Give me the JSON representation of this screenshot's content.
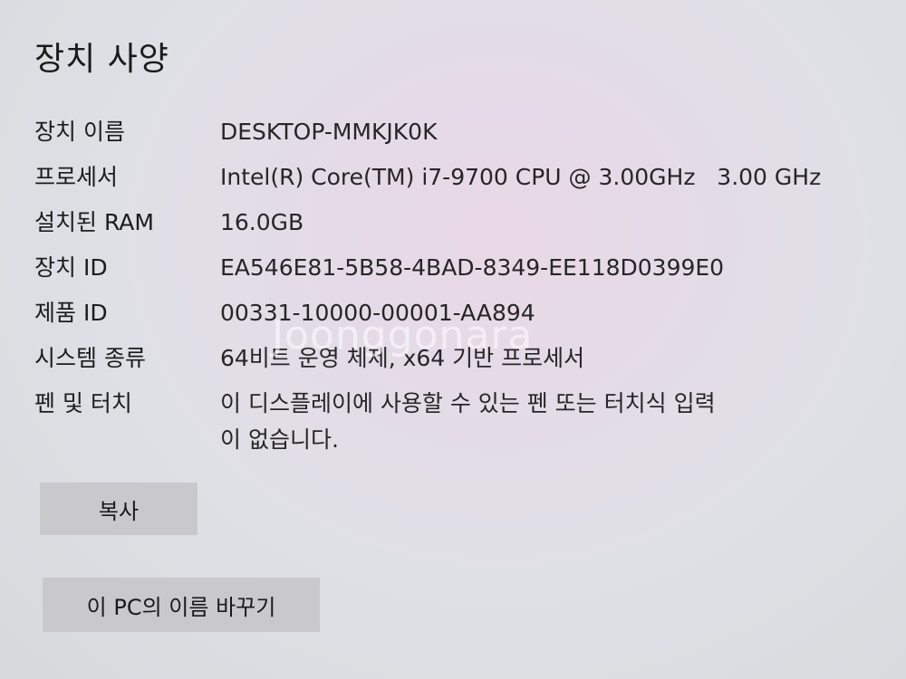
{
  "title": "장치 사양",
  "specs": [
    {
      "label": "장치 이름",
      "value": "DESKTOP-MMKJK0K"
    },
    {
      "label": "프로세서",
      "value": "Intel(R) Core(TM) i7-9700 CPU @ 3.00GHz   3.00 GHz"
    },
    {
      "label": "설치된 RAM",
      "value": "16.0GB"
    },
    {
      "label": "장치 ID",
      "value": "EA546E81-5B58-4BAD-8349-EE118D0399E0"
    },
    {
      "label": "제품 ID",
      "value": "00331-10000-00001-AA894"
    },
    {
      "label": "시스템 종류",
      "value": "64비트 운영 체제, x64 기반 프로세서"
    },
    {
      "label": "펜 및 터치",
      "value": "이 디스플레이에 사용할 수 있는 펜 또는 터치식 입력\n이 없습니다."
    }
  ],
  "buttons": {
    "copy_label": "복사",
    "rename_label": "이 PC의 이름 바꾸기"
  },
  "watermark": "Joonggonara"
}
